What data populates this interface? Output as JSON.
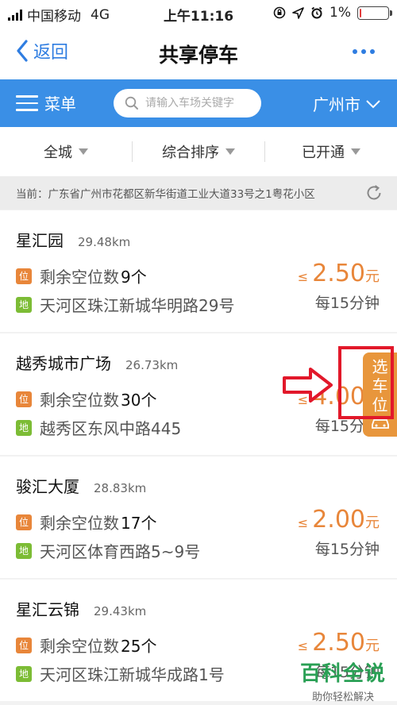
{
  "status_bar": {
    "carrier": "中国移动",
    "network": "4G",
    "time": "上午11:16",
    "battery": "1%",
    "battery_level": 0.05
  },
  "nav": {
    "back_label": "返回",
    "title": "共享停车"
  },
  "toolbar": {
    "menu_label": "菜单",
    "search_placeholder": "请输入车场关键字",
    "city": "广州市"
  },
  "filters": [
    {
      "label": "全城"
    },
    {
      "label": "综合排序"
    },
    {
      "label": "已开通"
    }
  ],
  "location": {
    "text": "当前：广东省广州市花都区新华街道工业大道33号之1粤花小区"
  },
  "tags": {
    "position": "位",
    "address": "地"
  },
  "lots": [
    {
      "name": "星汇园",
      "distance": "29.48km",
      "spaces_label": "剩余空位数",
      "spaces": "9个",
      "address": "天河区珠江新城华明路29号",
      "price_prefix": "≤",
      "price": "2.50",
      "price_unit": "元",
      "per": "每15分钟"
    },
    {
      "name": "越秀城市广场",
      "distance": "26.73km",
      "spaces_label": "剩余空位数",
      "spaces": "30个",
      "address": "越秀区东风中路445",
      "price_prefix": "≤",
      "price": "4.00",
      "price_unit": "元",
      "per": "每15分钟"
    },
    {
      "name": "骏汇大厦",
      "distance": "28.83km",
      "spaces_label": "剩余空位数",
      "spaces": "17个",
      "address": "天河区体育西路5~9号",
      "price_prefix": "≤",
      "price": "2.00",
      "price_unit": "元",
      "per": "每15分钟"
    },
    {
      "name": "星汇云锦",
      "distance": "29.43km",
      "spaces_label": "剩余空位数",
      "spaces": "25个",
      "address": "天河区珠江新城华成路1号",
      "price_prefix": "≤",
      "price": "2.50",
      "price_unit": "元",
      "per": "每15分钟"
    }
  ],
  "select_tab": {
    "l1": "选",
    "l2": "车",
    "l3": "位"
  },
  "watermark": {
    "title": "百科全说",
    "subtitle": "助你轻松解决"
  }
}
